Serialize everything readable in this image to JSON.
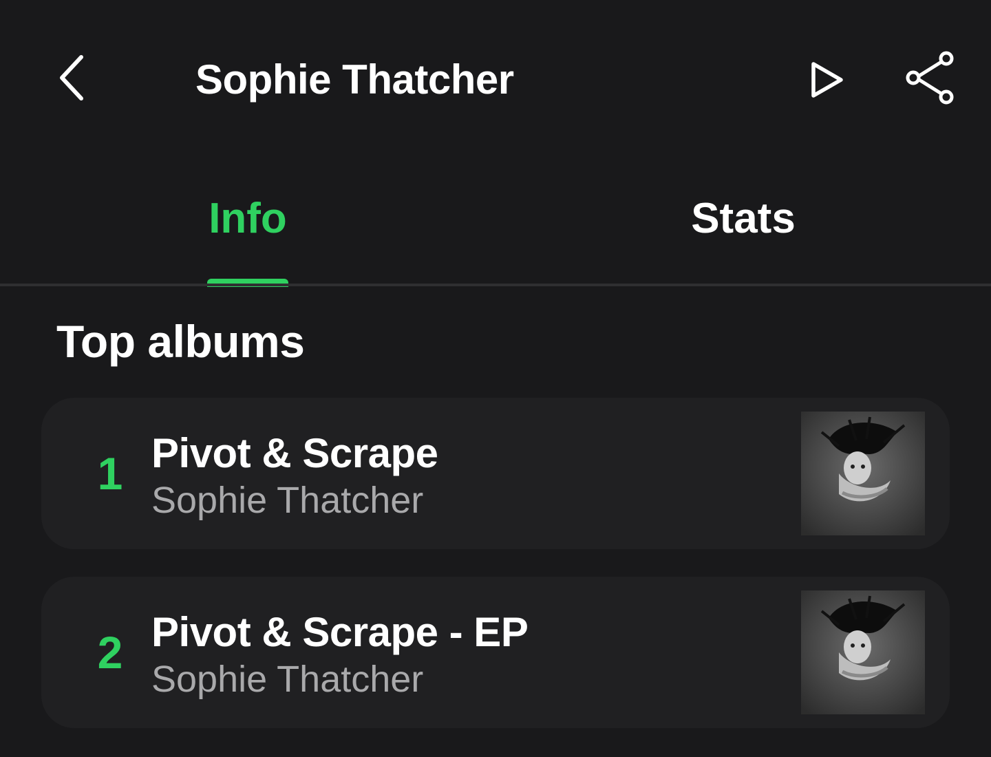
{
  "header": {
    "title": "Sophie Thatcher",
    "back_icon": "chevron-left-icon",
    "play_icon": "play-icon",
    "share_icon": "share-icon"
  },
  "tabs": [
    {
      "label": "Info",
      "selected": true
    },
    {
      "label": "Stats",
      "selected": false
    }
  ],
  "section": {
    "title": "Top albums"
  },
  "albums": [
    {
      "rank": "1",
      "title": "Pivot & Scrape",
      "artist": "Sophie Thatcher"
    },
    {
      "rank": "2",
      "title": "Pivot & Scrape - EP",
      "artist": "Sophie Thatcher"
    }
  ],
  "colors": {
    "background": "#19191b",
    "card": "#202022",
    "accent": "#2fd160",
    "text_primary": "#ffffff",
    "text_secondary": "#a9a9ab"
  }
}
